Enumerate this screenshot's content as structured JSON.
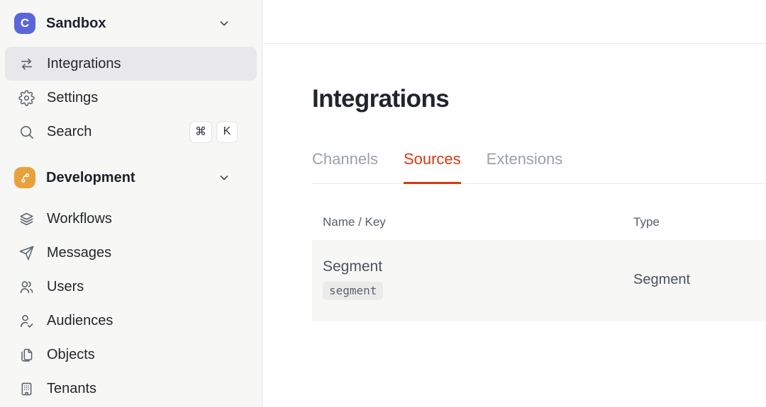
{
  "app": {
    "logo_letter": "C",
    "colors": {
      "accent_red": "#d23b10",
      "logo_indigo": "#5a67d8",
      "dev_orange": "#e9a23b",
      "sidebar_bg": "#f7f7f5",
      "selected_bg": "#e8e8ea"
    }
  },
  "sidebar": {
    "workspace": {
      "name": "Sandbox",
      "icon": "workspace-logo-c"
    },
    "nav_top": [
      {
        "label": "Integrations",
        "icon": "transfer-arrows-icon",
        "active": true
      },
      {
        "label": "Settings",
        "icon": "gear-icon",
        "active": false
      },
      {
        "label": "Search",
        "icon": "search-icon",
        "active": false
      }
    ],
    "search_shortcut": {
      "meta_key": "⌘",
      "letter_key": "K"
    },
    "section": {
      "name": "Development",
      "icon": "git-branch-icon"
    },
    "nav_dev": [
      {
        "label": "Workflows",
        "icon": "layers-icon"
      },
      {
        "label": "Messages",
        "icon": "paper-plane-icon"
      },
      {
        "label": "Users",
        "icon": "two-users-icon"
      },
      {
        "label": "Audiences",
        "icon": "user-check-icon"
      },
      {
        "label": "Objects",
        "icon": "copy-pages-icon"
      },
      {
        "label": "Tenants",
        "icon": "building-icon"
      }
    ]
  },
  "main": {
    "title": "Integrations",
    "tabs": [
      {
        "label": "Channels",
        "active": false
      },
      {
        "label": "Sources",
        "active": true
      },
      {
        "label": "Extensions",
        "active": false
      }
    ],
    "table": {
      "columns": [
        "Name / Key",
        "Type"
      ],
      "rows": [
        {
          "name": "Segment",
          "key": "segment",
          "type": "Segment"
        }
      ]
    }
  }
}
